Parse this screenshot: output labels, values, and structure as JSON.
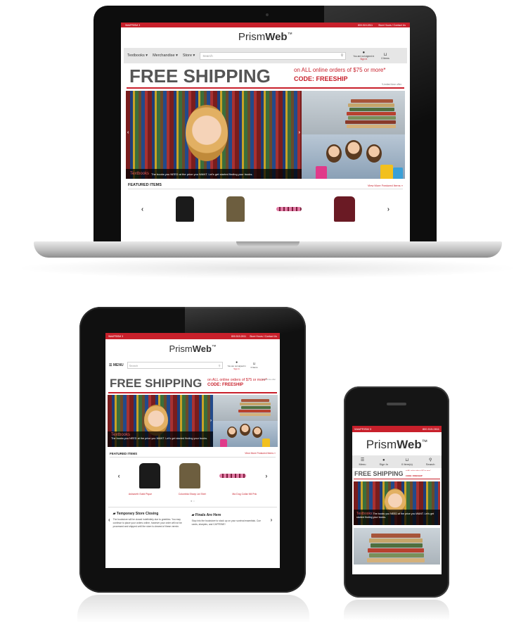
{
  "laptop": {
    "topbar": {
      "left": "WebPRISM 3",
      "phone": "800.515.2811",
      "links": "Store Hours / Contact Us"
    },
    "logo": {
      "light": "Prism",
      "bold": "Web",
      "tm": "™"
    },
    "nav": {
      "textbooks": "Textbooks",
      "merchandise": "Merchandise",
      "store": "Store",
      "search_placeholder": "Search",
      "account_line1": "You are not signed in",
      "account_line2": "Sign In",
      "cart": "0 Items"
    },
    "promo": {
      "headline": "FREE SHIPPING",
      "line1": "on ALL online orders of $75 or more*",
      "code": "CODE: FREESHIP",
      "footnote": "*Limited time offer"
    },
    "hero_caption": {
      "title": "Textbooks",
      "text": "The books you NEED at the price you WANT. Let's get started finding your books."
    },
    "featured": {
      "title": "FEATURED ITEMS",
      "view_more": "View More Featured Items »"
    }
  },
  "tablet": {
    "topbar": {
      "left": "WebPRISM 3",
      "phone": "800.515.2811",
      "links": "Store Hours / Contact Us"
    },
    "logo": {
      "light": "Prism",
      "bold": "Web",
      "tm": "™"
    },
    "menu": "MENU",
    "search_placeholder": "Search",
    "account_line1": "You are not signed in",
    "account_line2": "Sign In",
    "cart": "0 Items",
    "promo": {
      "headline": "FREE SHIPPING",
      "line1": "on ALL online orders of $75 or more*",
      "code": "CODE: FREESHIP",
      "footnote": "*Limited time offer"
    },
    "hero_caption": {
      "title": "Textbooks",
      "text": "The books you NEED at the price you WANT. Let's get started finding your books."
    },
    "featured": {
      "title": "FEATURED ITEMS",
      "view_more": "View More Featured Items »"
    },
    "products": [
      "Ashworth Solid Pique",
      "Columbia Sharp Lid Shirt",
      "Ma Dog Collar Mil Pnk"
    ],
    "news": [
      {
        "title": "Temporary Store Closing",
        "body": "The bookstore will be closed indefinitely due to greeblez. You may continue to place your orders online, however your order will not be processed and shipped until the store is cleared of these vermin."
      },
      {
        "title": "Finals Are Here",
        "body": "Stop into the bookstore to stock up on your survival essentials. Cue cards, sharpies, and CAFFEINE!"
      }
    ]
  },
  "phone": {
    "topbar": {
      "left": "WebPRISM 3",
      "phone": "800.515.2811"
    },
    "logo": {
      "light": "Prism",
      "bold": "Web",
      "tm": "™"
    },
    "nav": {
      "menu": "Menu",
      "signin": "Sign In",
      "cart": "0 Item(s)",
      "search": "Search"
    },
    "promo": {
      "headline": "FREE SHIPPING",
      "line1": "on ALL online orders of $75 or more*",
      "code": "CODE: FREESHIP"
    },
    "hero_caption": {
      "title": "Textbooks",
      "text": "The books you NEED at the price you WANT. Let's get started finding your books."
    }
  },
  "colors": {
    "brand_red": "#c8202b",
    "text_dark": "#333333",
    "promo_gray": "#555555"
  },
  "icons": [
    "chevron-down-icon",
    "search-icon",
    "user-icon",
    "cart-icon",
    "menu-icon",
    "chevron-left-icon",
    "chevron-right-icon",
    "comment-icon"
  ]
}
